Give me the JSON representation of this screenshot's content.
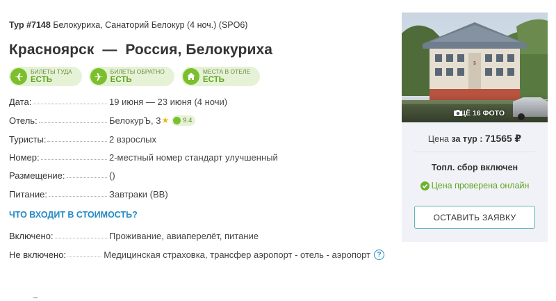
{
  "tour": {
    "id_label": "Тур #7148",
    "description": "Белокуриха, Санаторий Белокур (4 ноч.) (SPO6)",
    "route": "Красноярск  —  Россия, Белокуриха"
  },
  "badges": [
    {
      "top": "Билеты туда",
      "bottom": "ЕСТЬ",
      "icon": "plane-icon"
    },
    {
      "top": "Билеты обратно",
      "bottom": "ЕСТЬ",
      "icon": "plane-return-icon"
    },
    {
      "top": "Места в отеле",
      "bottom": "ЕСТЬ",
      "icon": "house-icon"
    }
  ],
  "details": {
    "date": {
      "label": "Дата:",
      "value": "19 июня — 23 июня (4 ночи)"
    },
    "hotel": {
      "label": "Отель:",
      "value": "БелокурЪ, 3",
      "rating": "9.4"
    },
    "tourists": {
      "label": "Туристы:",
      "value": "2 взрослых"
    },
    "room": {
      "label": "Номер:",
      "value": "2-местный номер стандарт улучшенный"
    },
    "placement": {
      "label": "Размещение:",
      "value": "()"
    },
    "meals": {
      "label": "Питание:",
      "value": "Завтраки (BB)"
    }
  },
  "included_section": {
    "title": "Что входит в стоимость?",
    "included": {
      "label": "Включено:",
      "value": "Проживание, авиаперелёт, питание"
    },
    "not_included": {
      "label": "Не включено:",
      "value": "Медицинская страховка, трансфер аэропорт - отель - аэропорт"
    }
  },
  "photo": {
    "count_label": "ЕЩЁ 16 ФОТО"
  },
  "price_panel": {
    "price_prefix": "Цена",
    "price_for": "за тур :",
    "amount": "71565",
    "currency": "₽",
    "fee_text": "Топл. сбор включен",
    "verified_text": "Цена проверена онлайн",
    "order_button": "Оставить заявку"
  },
  "colors": {
    "accent_green": "#7cbf2d",
    "link_blue": "#2489c5",
    "button_border": "#5bb3b6",
    "panel_bg": "#f1f2f7"
  }
}
